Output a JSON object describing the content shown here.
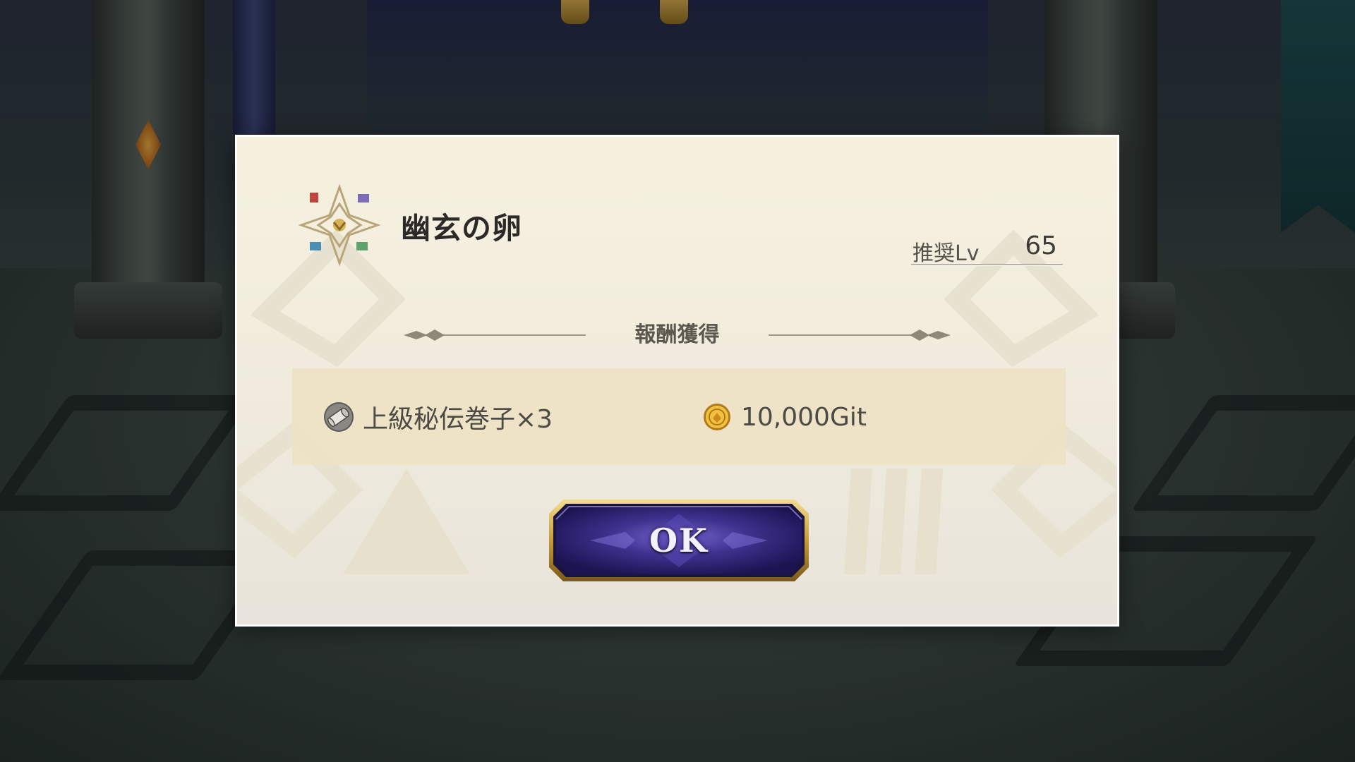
{
  "dialog": {
    "title": "幽玄の卵",
    "emblem_icon": "quest-crest-icon",
    "recommended_level": {
      "label": "推奨Lv",
      "value": "65"
    },
    "section_title": "報酬獲得",
    "rewards": [
      {
        "icon": "scroll-icon",
        "label": "上級秘伝巻子×3"
      },
      {
        "icon": "gold-coin-icon",
        "label": "10,000Git"
      }
    ],
    "ok_label": "OK"
  },
  "colors": {
    "panel": "#f2eddd",
    "reward_band": "#eee2c3",
    "button_fill": "#3a2f86",
    "button_border": "#c9a24a",
    "text": "#4c4a45"
  }
}
